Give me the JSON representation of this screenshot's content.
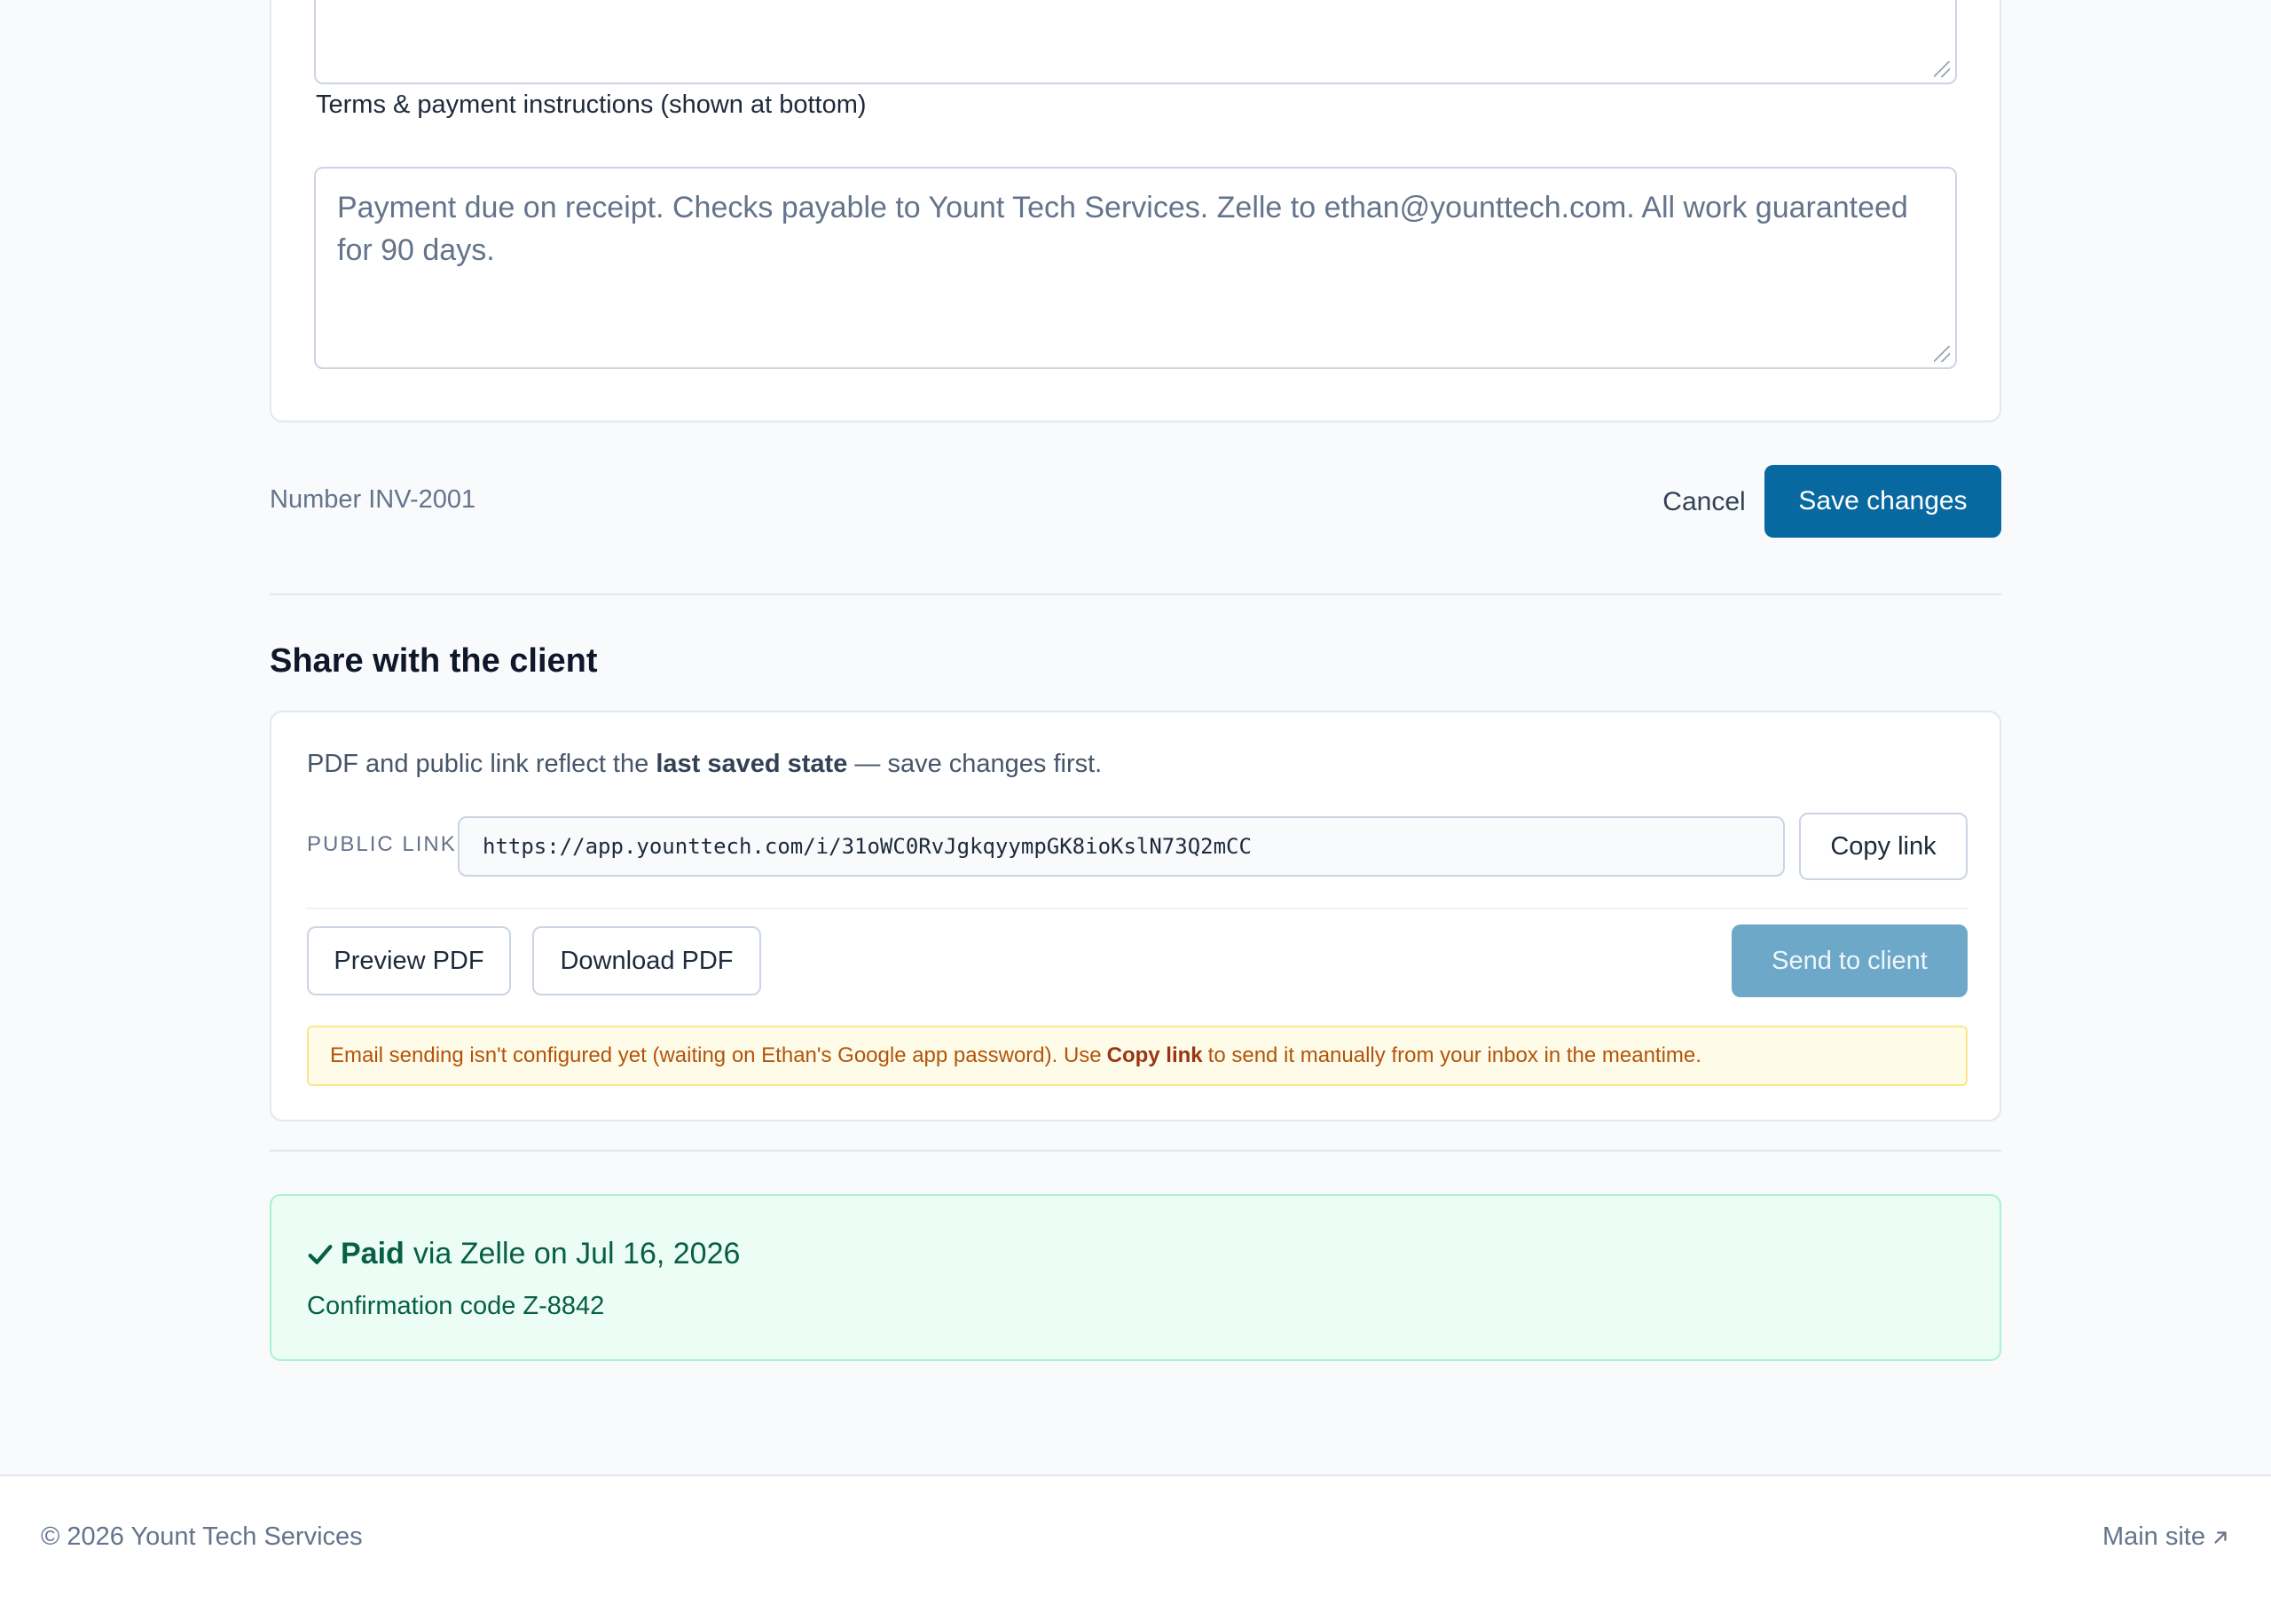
{
  "form": {
    "terms_label": "Terms & payment instructions (shown at bottom)",
    "terms_value": "Payment due on receipt. Checks payable to Yount Tech Services. Zelle to ethan@younttech.com. All work guaranteed for 90 days.",
    "number_text": "Number INV-2001",
    "cancel_label": "Cancel",
    "save_label": "Save changes"
  },
  "share": {
    "title": "Share with the client",
    "note_prefix": "PDF and public link reflect the",
    "note_bold": "last saved state",
    "note_suffix": "— save changes first.",
    "link_label": "PUBLIC LINK",
    "link_value": "https://app.younttech.com/i/31oWC0RvJgkqyympGK8ioKslN73Q2mCC",
    "copy_label": "Copy link",
    "preview_label": "Preview PDF",
    "download_label": "Download PDF",
    "send_label": "Send to client",
    "warning_prefix": "Email sending isn't configured yet (waiting on Ethan's Google app password). Use",
    "warning_bold": "Copy link",
    "warning_suffix": "to send it manually from your inbox in the meantime."
  },
  "payment": {
    "status": "Paid",
    "detail": "via Zelle on Jul 16, 2026",
    "confirmation": "Confirmation code Z-8842",
    "icon": "check-icon"
  },
  "footer": {
    "copyright": "© 2026 Yount Tech Services",
    "main_site": "Main site",
    "icon": "external-arrow-icon"
  },
  "colors": {
    "primary": "#0869a0",
    "disabled_primary": "#6ea8c9",
    "success_bg": "#ecfdf5",
    "warning_bg": "#fefce8"
  }
}
